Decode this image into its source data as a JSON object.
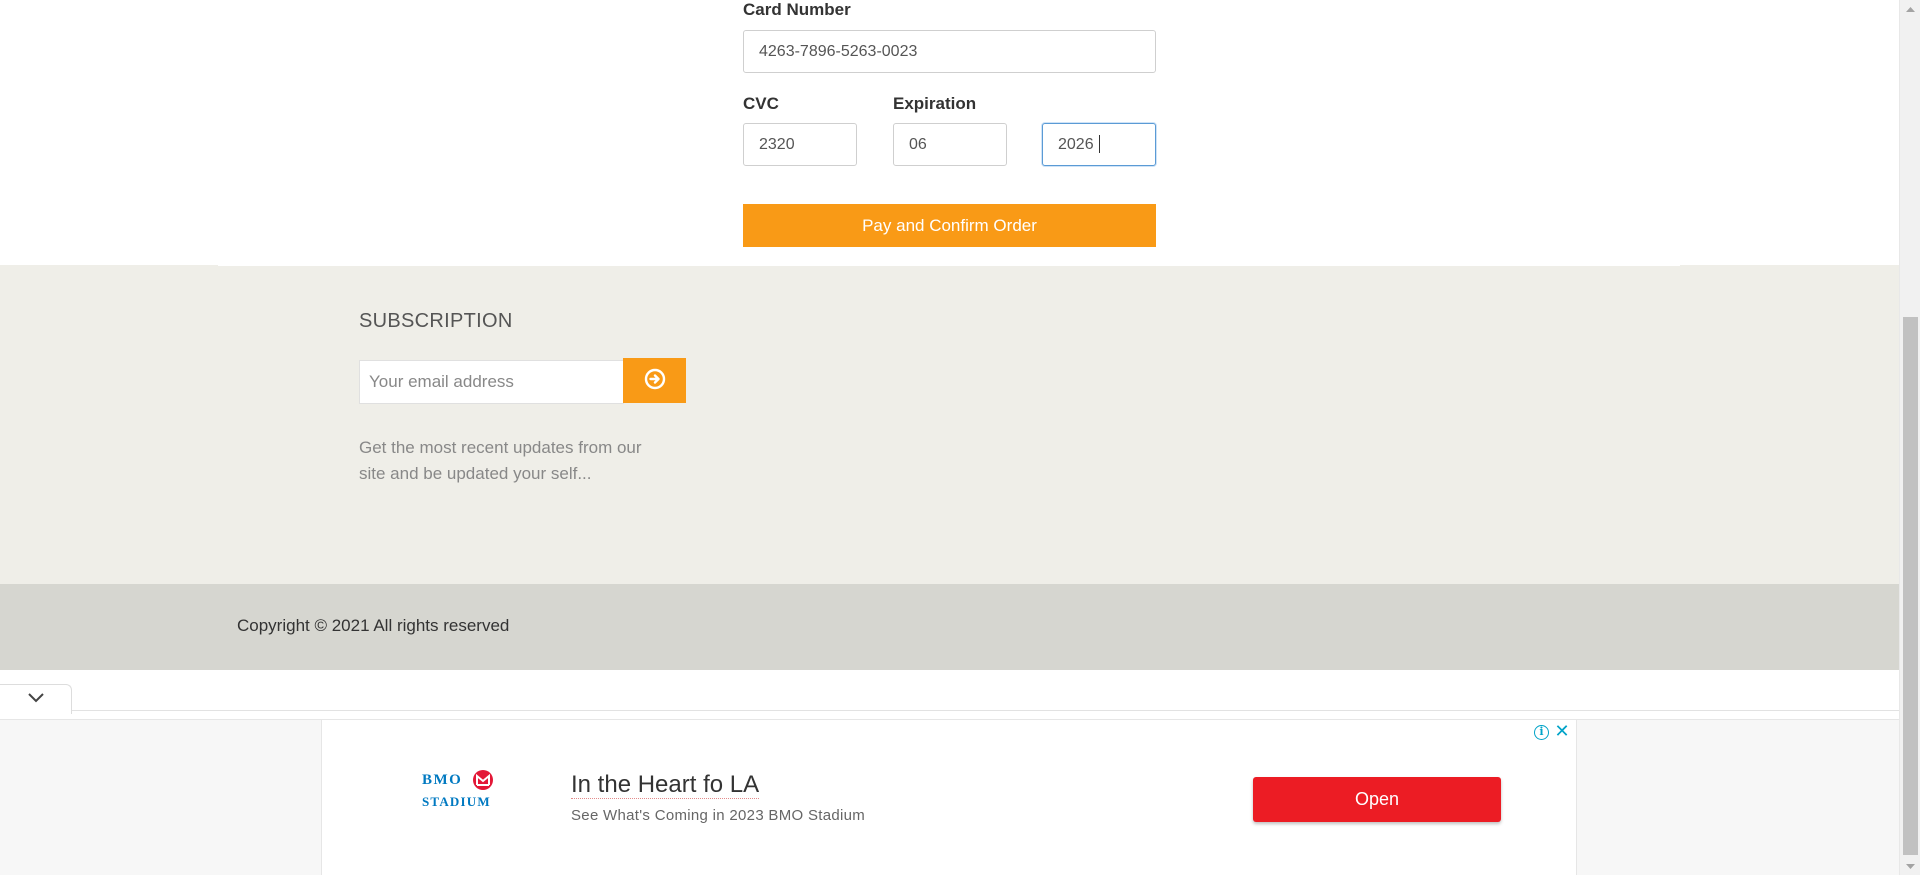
{
  "payment": {
    "card_number_label": "Card Number",
    "card_number_value": "4263-7896-5263-0023",
    "cvc_label": "CVC",
    "cvc_value": "2320",
    "expiration_label": "Expiration",
    "exp_month_value": "06",
    "exp_year_value": "2026",
    "submit_label": "Pay and Confirm Order",
    "accent_color": "#f99a16"
  },
  "subscription": {
    "title": "SUBSCRIPTION",
    "email_placeholder": "Your email address",
    "submit_icon": "arrow-circle-right-icon",
    "description": "Get the most recent updates from our site and be updated your self..."
  },
  "footer": {
    "copyright": "Copyright © 2021 All rights reserved"
  },
  "ad": {
    "collapse_icon": "chevron-down-icon",
    "info_icon": "info-icon",
    "close_icon": "close-icon",
    "logo_line1": "BMO",
    "logo_line2": "STADIUM",
    "headline": "In the Heart fo LA",
    "subline": "See What's Coming in 2023 BMO Stadium",
    "cta_label": "Open",
    "cta_color": "#ec1c24",
    "brand_color": "#0079c1"
  }
}
